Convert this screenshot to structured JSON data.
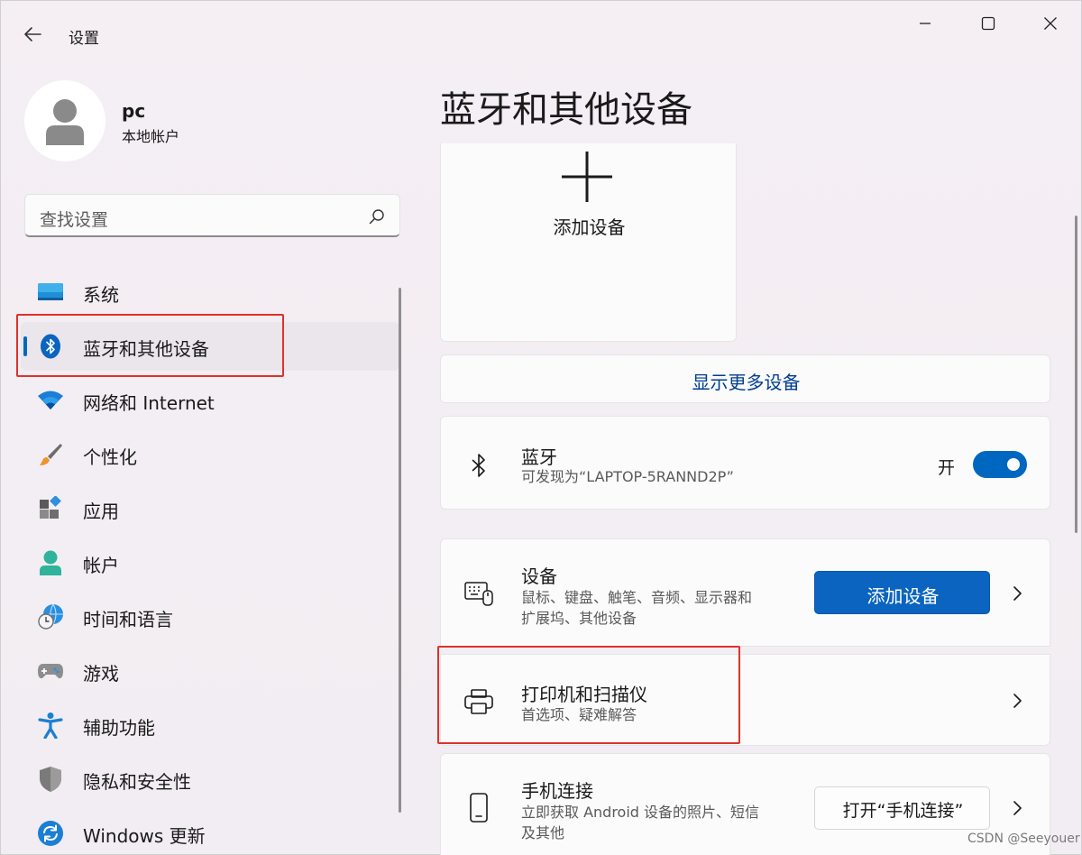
{
  "window": {
    "title": "设置"
  },
  "profile": {
    "name": "pc",
    "account_type": "本地帐户"
  },
  "search": {
    "placeholder": "查找设置"
  },
  "sidebar": {
    "items": [
      {
        "label": "系统",
        "icon": "system-icon"
      },
      {
        "label": "蓝牙和其他设备",
        "icon": "bluetooth-icon",
        "active": true
      },
      {
        "label": "网络和 Internet",
        "icon": "wifi-icon"
      },
      {
        "label": "个性化",
        "icon": "brush-icon"
      },
      {
        "label": "应用",
        "icon": "apps-icon"
      },
      {
        "label": "帐户",
        "icon": "account-icon"
      },
      {
        "label": "时间和语言",
        "icon": "clock-globe-icon"
      },
      {
        "label": "游戏",
        "icon": "gamepad-icon"
      },
      {
        "label": "辅助功能",
        "icon": "accessibility-icon"
      },
      {
        "label": "隐私和安全性",
        "icon": "shield-icon"
      },
      {
        "label": "Windows 更新",
        "icon": "update-icon"
      }
    ]
  },
  "main": {
    "title": "蓝牙和其他设备",
    "add_tile": {
      "label": "添加设备"
    },
    "show_more": "显示更多设备",
    "bluetooth": {
      "title": "蓝牙",
      "subtitle": "可发现为“LAPTOP-5RANND2P”",
      "state_label": "开",
      "on": true
    },
    "devices": {
      "title": "设备",
      "subtitle_line1": "鼠标、键盘、触笔、音频、显示器和",
      "subtitle_line2": "扩展坞、其他设备",
      "button": "添加设备"
    },
    "printers": {
      "title": "打印机和扫描仪",
      "subtitle": "首选项、疑难解答"
    },
    "phone": {
      "title": "手机连接",
      "subtitle_line1": "立即获取 Android 设备的照片、短信",
      "subtitle_line2": "及其他",
      "button": "打开“手机连接”"
    }
  },
  "watermark": "CSDN @Seeyouer",
  "colors": {
    "accent": "#0067c0",
    "highlight_box": "#e0312b",
    "link": "#003e92"
  }
}
